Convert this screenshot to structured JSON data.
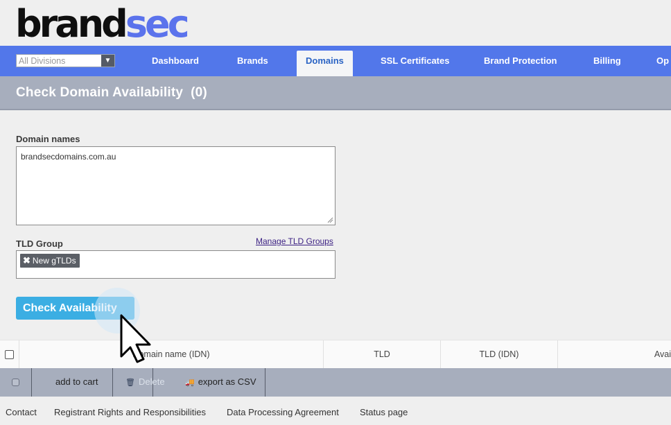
{
  "logo": {
    "part1": "brand",
    "part2": "sec"
  },
  "nav": {
    "division_select": "All Divisions",
    "items": [
      "Dashboard",
      "Brands",
      "Domains",
      "SSL Certificates",
      "Brand Protection",
      "Billing",
      "Op"
    ],
    "active": "Domains"
  },
  "page": {
    "title": "Check Domain Availability",
    "count": "(0)"
  },
  "form": {
    "domain_label": "Domain names",
    "domain_value": "brandsecdomains.com.au",
    "tld_label": "TLD Group",
    "manage_link": "Manage TLD Groups",
    "tld_chip": "New gTLDs",
    "submit_label": "Check Availability"
  },
  "table": {
    "columns": [
      "Domain name (IDN)",
      "TLD",
      "TLD (IDN)",
      "Avai"
    ]
  },
  "actions": {
    "add_to_cart": "add to cart",
    "delete": "Delete",
    "export": "export as CSV"
  },
  "footer": [
    "Contact",
    "Registrant Rights and Responsibilities",
    "Data Processing Agreement",
    "Status page"
  ],
  "colors": {
    "nav": "#5277ea",
    "logo_accent": "#5b73ec",
    "button": "#3baee3",
    "section_bar": "#a7aebd"
  }
}
